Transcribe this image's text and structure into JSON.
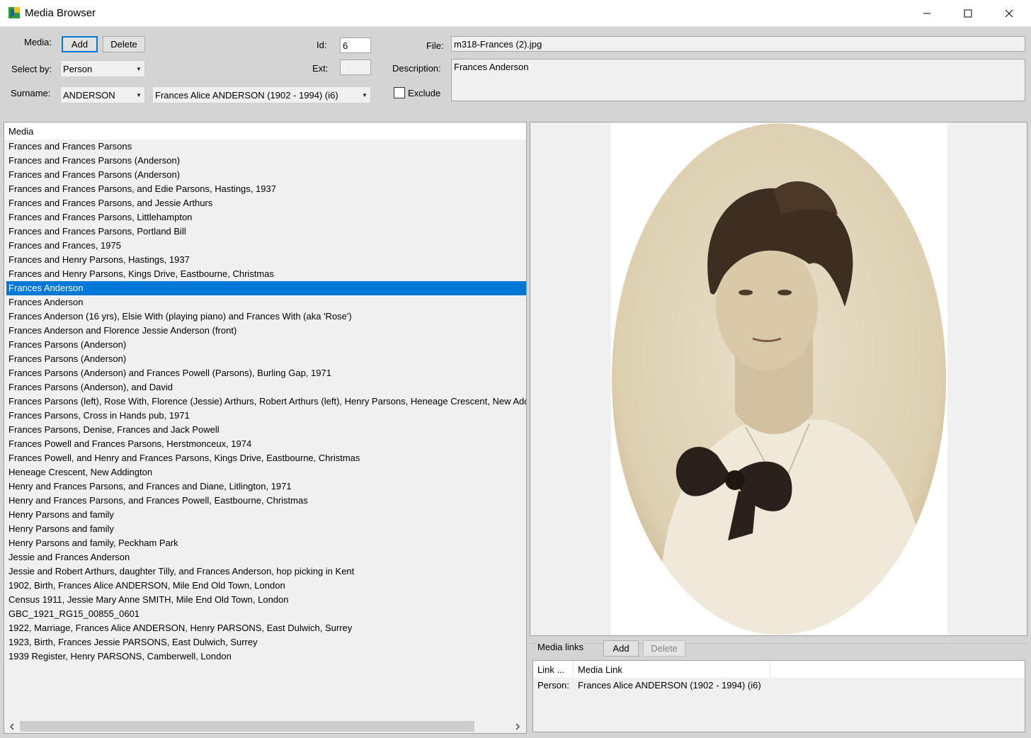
{
  "window": {
    "title": "Media Browser",
    "minimize": "—",
    "maximize": "☐",
    "close": "✕"
  },
  "form": {
    "media_label": "Media:",
    "add_label": "Add",
    "delete_label": "Delete",
    "select_by_label": "Select by:",
    "select_by_value": "Person",
    "surname_label": "Surname:",
    "surname_value": "ANDERSON",
    "person_value": "Frances Alice ANDERSON  (1902 - 1994)  (i6)",
    "id_label": "Id:",
    "id_value": "6",
    "ext_label": "Ext:",
    "ext_value": "",
    "file_label": "File:",
    "file_value": "m318-Frances (2).jpg",
    "description_label": "Description:",
    "description_value": "Frances Anderson",
    "exclude_label": "Exclude",
    "exclude_checked": false
  },
  "media_list": {
    "header": "Media",
    "selected_index": 10,
    "items": [
      "Frances and Frances Parsons",
      "Frances and Frances Parsons (Anderson)",
      "Frances and Frances Parsons (Anderson)",
      "Frances and Frances Parsons, and Edie Parsons, Hastings, 1937",
      "Frances and Frances Parsons, and Jessie Arthurs",
      "Frances and Frances Parsons, Littlehampton",
      "Frances and Frances Parsons, Portland Bill",
      "Frances and Frances, 1975",
      "Frances and Henry Parsons, Hastings, 1937",
      "Frances and Henry Parsons, Kings Drive, Eastbourne, Christmas",
      "Frances Anderson",
      "Frances Anderson",
      "Frances Anderson (16 yrs), Elsie With (playing piano) and Frances With (aka 'Rose')",
      "Frances Anderson and Florence Jessie Anderson (front)",
      "Frances Parsons (Anderson)",
      "Frances Parsons (Anderson)",
      "Frances Parsons (Anderson) and Frances Powell (Parsons), Burling Gap, 1971",
      "Frances Parsons (Anderson), and David",
      "Frances Parsons (left),  Rose With, Florence (Jessie) Arthurs, Robert Arthurs (left), Henry Parsons, Heneage Crescent, New Addington",
      "Frances Parsons, Cross in Hands pub, 1971",
      "Frances Parsons, Denise, Frances and Jack Powell",
      "Frances Powell and Frances Parsons, Herstmonceux, 1974",
      "Frances Powell, and Henry and Frances Parsons, Kings Drive, Eastbourne, Christmas",
      "Heneage Crescent, New Addington",
      "Henry and Frances Parsons, and Frances and Diane, Litlington, 1971",
      "Henry and Frances Parsons, and Frances Powell, Eastbourne, Christmas",
      "Henry Parsons and family",
      "Henry Parsons and family",
      "Henry Parsons and family, Peckham Park",
      "Jessie and Frances Anderson",
      "Jessie and Robert Arthurs, daughter Tilly, and Frances Anderson, hop picking in Kent",
      "1902, Birth, Frances Alice ANDERSON, Mile End Old Town, London",
      "Census 1911, Jessie Mary Anne SMITH, Mile End Old Town, London",
      "GBC_1921_RG15_00855_0601",
      "1922, Marriage, Frances Alice ANDERSON, Henry PARSONS, East Dulwich, Surrey",
      "1923, Birth, Frances Jessie PARSONS, East Dulwich, Surrey",
      "1939 Register, Henry PARSONS, Camberwell, London"
    ]
  },
  "media_links": {
    "label": "Media links",
    "add_label": "Add",
    "delete_label": "Delete",
    "col_type": "Link ...",
    "col_link": "Media Link",
    "rows": [
      {
        "type": "Person:",
        "link": "Frances Alice ANDERSON  (1902 - 1994)  (i6)"
      }
    ]
  },
  "colors": {
    "selection": "#0078d7",
    "window_bg": "#d4d4d4",
    "sepia_bg": "#e6dcc4"
  }
}
